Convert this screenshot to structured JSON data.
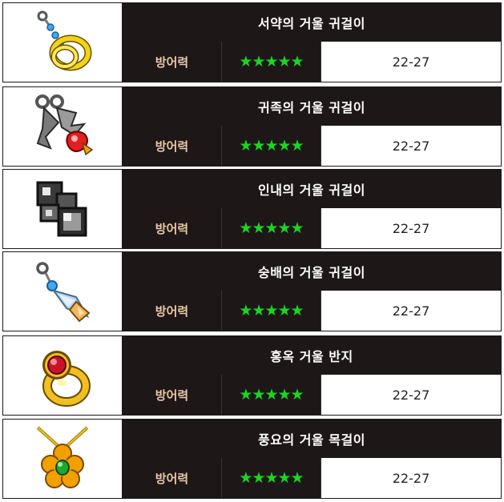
{
  "items": [
    {
      "name": "서약의 거울 귀걸이",
      "stat": "방어력",
      "stars": "★★★★★",
      "value": "22-27",
      "icon": "gold-ring-earring-icon"
    },
    {
      "name": "귀족의 거울 귀걸이",
      "stat": "방어력",
      "stars": "★★★★★",
      "value": "22-27",
      "icon": "noble-wing-ruby-earring-icon"
    },
    {
      "name": "인내의 거울 귀걸이",
      "stat": "방어력",
      "stars": "★★★★★",
      "value": "22-27",
      "icon": "square-block-earring-icon"
    },
    {
      "name": "숭배의 거울 귀걸이",
      "stat": "방어력",
      "stars": "★★★★★",
      "value": "22-27",
      "icon": "crystal-drop-earring-icon"
    },
    {
      "name": "홍옥 거울 반지",
      "stat": "방어력",
      "stars": "★★★★★",
      "value": "22-27",
      "icon": "ruby-ring-icon"
    },
    {
      "name": "풍요의 거울 목걸이",
      "stat": "방어력",
      "stars": "★★★★★",
      "value": "22-27",
      "icon": "flower-emerald-necklace-icon"
    }
  ]
}
